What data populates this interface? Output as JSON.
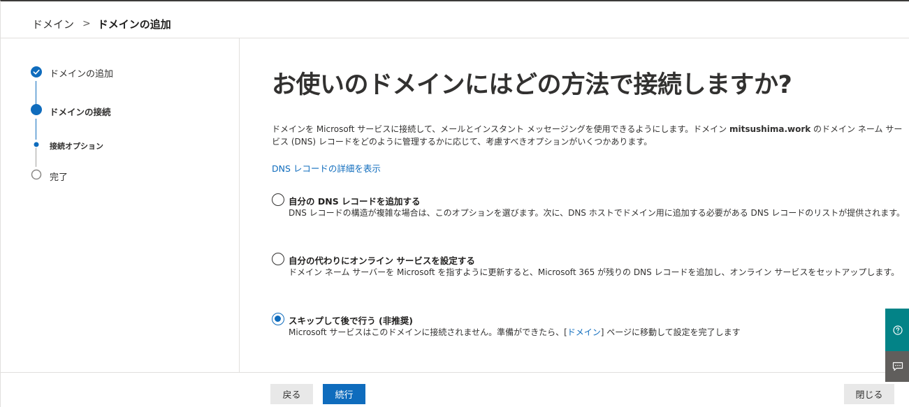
{
  "header": {
    "breadcrumb_parent": "ドメイン",
    "breadcrumb_separator": ">",
    "breadcrumb_current": "ドメインの追加"
  },
  "stepper": {
    "steps": [
      {
        "label": "ドメインの追加",
        "state": "completed"
      },
      {
        "label": "ドメインの接続",
        "state": "current"
      },
      {
        "label": "接続オプション",
        "state": "current-substep"
      },
      {
        "label": "完了",
        "state": "pending"
      }
    ]
  },
  "main": {
    "title": "お使いのドメインにはどの方法で接続しますか?",
    "intro_part1": "ドメインを Microsoft サービスに接続して、メールとインスタント メッセージングを使用できるようにします。ドメイン ",
    "intro_domain": "mitsushima.work",
    "intro_part2": " のドメイン ネーム サービス (DNS) レコードをどのように管理するかに応じて、考慮すべきオプションがいくつかあります。",
    "details_link": "DNS レコードの詳細を表示",
    "options": [
      {
        "title": "自分の DNS レコードを追加する",
        "description": "DNS レコードの構造が複雑な場合は、このオプションを選びます。次に、DNS ホストでドメイン用に追加する必要がある DNS レコードのリストが提供されます。",
        "selected": false
      },
      {
        "title": "自分の代わりにオンライン サービスを設定する",
        "description": "ドメイン ネーム サーバーを Microsoft を指すように更新すると、Microsoft 365 が残りの DNS レコードを追加し、オンライン サービスをセットアップします。",
        "selected": false
      },
      {
        "title": "スキップして後で行う (非推奨)",
        "description_part1": "Microsoft サービスはこのドメインに接続されません。準備ができたら、[",
        "description_link": "ドメイン",
        "description_part2": "] ページに移動して設定を完了します",
        "selected": true
      }
    ]
  },
  "footer": {
    "back_label": "戻る",
    "next_label": "続行",
    "close_label": "閉じる"
  },
  "side_buttons": {
    "help_icon": "help-circle-icon",
    "feedback_icon": "chat-feedback-icon"
  },
  "colors": {
    "accent": "#0f6cbd",
    "help_button": "#038387",
    "feedback_button": "#605e5c"
  }
}
